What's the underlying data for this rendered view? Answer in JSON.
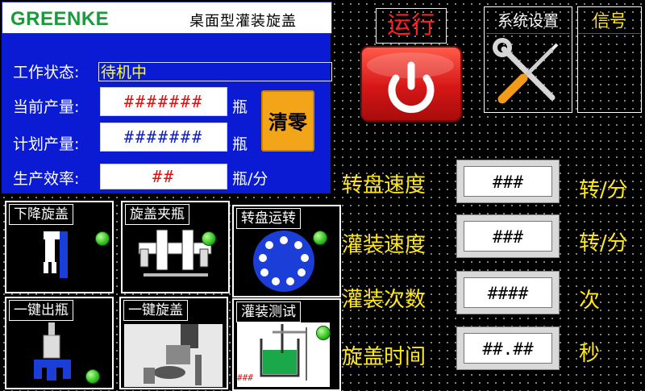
{
  "header": {
    "logo": "GREENKE",
    "title": "桌面型灌装旋盖"
  },
  "status": {
    "label": "工作状态:",
    "value": "待机中"
  },
  "current_output": {
    "label": "当前产量:",
    "value": "#######",
    "unit": "瓶"
  },
  "planned_output": {
    "label": "计划产量:",
    "value": "#######",
    "unit": "瓶"
  },
  "efficiency": {
    "label": "生产效率:",
    "value": "##",
    "unit": "瓶/分"
  },
  "clear_button": "清零",
  "tiles": [
    {
      "label": "下降旋盖",
      "icon": "capping-down-icon"
    },
    {
      "label": "旋盖夹瓶",
      "icon": "bottle-clamp-icon"
    },
    {
      "label": "转盘运转",
      "icon": "turntable-icon"
    },
    {
      "label": "一键出瓶",
      "icon": "bottle-eject-icon"
    },
    {
      "label": "一键旋盖",
      "icon": "capping-head-icon"
    },
    {
      "label": "灌装测试",
      "icon": "filling-test-icon",
      "small_text": "###"
    }
  ],
  "run": {
    "label": "运行",
    "icon": "power-icon"
  },
  "system_settings": {
    "label": "系统设置",
    "icon": "tools-icon"
  },
  "signal": {
    "label": "信号"
  },
  "params": [
    {
      "label": "转盘速度",
      "value": "###",
      "unit": "转/分"
    },
    {
      "label": "灌装速度",
      "value": "###",
      "unit": "转/分"
    },
    {
      "label": "灌装次数",
      "value": "####",
      "unit": "次"
    },
    {
      "label": "旋盖时间",
      "value": "##.##",
      "unit": "秒"
    }
  ],
  "colors": {
    "panel_blue": "#0b1bd4",
    "label_yellow": "#ffe81a",
    "run_red": "#e01a1a",
    "led_green": "#2fbf1d",
    "value_red": "#e01010",
    "value_blue": "#1020c0"
  }
}
